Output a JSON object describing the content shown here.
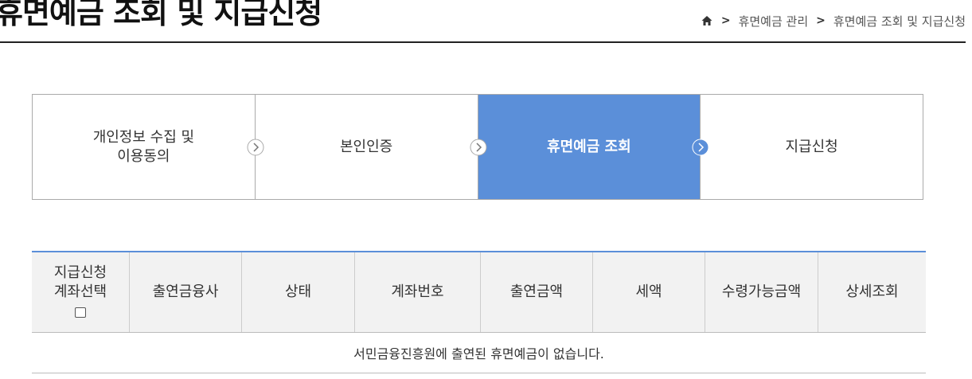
{
  "header": {
    "title": "휴면예금 조회 및 지급신청",
    "breadcrumb": [
      "휴면예금 관리",
      "휴면예금 조회 및 지급신청"
    ],
    "breadcrumb_sep": ">",
    "home_icon": "home-icon"
  },
  "steps": [
    {
      "line1": "개인정보 수집 및",
      "line2": "이용동의",
      "active": false
    },
    {
      "line1": "본인인증",
      "line2": "",
      "active": true
    },
    {
      "line1": "휴면예금 조회",
      "line2": "",
      "active": true
    },
    {
      "line1": "지급신청",
      "line2": "",
      "active": false
    }
  ],
  "accent_color": "#5b8fd9",
  "table": {
    "headers": {
      "select_line1": "지급신청",
      "select_line2": "계좌선택",
      "institution": "출연금융사",
      "status": "상태",
      "account": "계좌번호",
      "amount": "출연금액",
      "tax": "세액",
      "receivable": "수령가능금액",
      "detail": "상세조회"
    },
    "empty_message": "서민금융진흥원에 출연된 휴면예금이 없습니다."
  }
}
